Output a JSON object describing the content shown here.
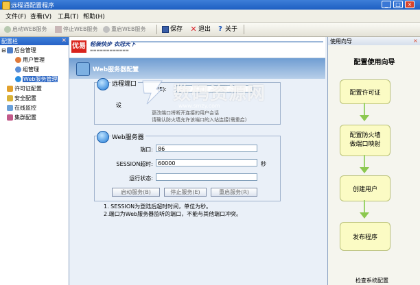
{
  "window": {
    "title": "远程通配置程序"
  },
  "menubar": [
    {
      "label": "文件(F)"
    },
    {
      "label": "查看(V)"
    },
    {
      "label": "工具(T)"
    },
    {
      "label": "帮助(H)"
    }
  ],
  "toolbar": {
    "start_web": "启动WEB服务",
    "stop_web": "停止WEB服务",
    "restart_web": "重启WEB服务",
    "save": "保存",
    "exit": "退出",
    "about": "关于"
  },
  "left_panel": {
    "title": "配置栏",
    "close": "×",
    "tree": [
      {
        "label": "后台管理",
        "level": 0,
        "expander": "⊟"
      },
      {
        "label": "用户管理",
        "level": 1
      },
      {
        "label": "组管理",
        "level": 1
      },
      {
        "label": "Web服务管理",
        "level": 1,
        "selected": true
      },
      {
        "label": "许可证配置",
        "level": 0
      },
      {
        "label": "安全配置",
        "level": 0
      },
      {
        "label": "在线监控",
        "level": 0
      },
      {
        "label": "集群配置",
        "level": 0
      }
    ]
  },
  "main": {
    "logo_text": "优易",
    "slogan": "轻装快步 衣冠天下",
    "section_title": "Web服务器配置",
    "remote_port": {
      "title": "远程端口",
      "field_suffix": "(E):",
      "row2_label": "设",
      "desc_line1": "更改端口将断开连接的用户会话",
      "desc_line2": "请确认防火墙允许该端口的入站连接(需重启)"
    },
    "web_server": {
      "title": "Web服务器",
      "port_label": "端口:",
      "port_value": "86",
      "session_label": "SESSION超时:",
      "session_value": "60000",
      "session_unit": "秒",
      "status_label": "运行状态:",
      "status_value": "",
      "btn_start": "启动服务(B)",
      "btn_stop": "停止服务(E)",
      "btn_restart": "重启服务(R)"
    },
    "notes": [
      "1. SESSION为登陆后超时时间，单位为秒。",
      "2.端口为Web服务器监听的端口，不能与其他端口冲突。"
    ]
  },
  "wizard": {
    "panel_title": "使用向导",
    "close": "×",
    "title": "配置使用向导",
    "steps": [
      {
        "label": "配置许可证"
      },
      {
        "label": "配置防火墙\n做端口映射"
      },
      {
        "label": "创建用户"
      },
      {
        "label": "发布程序"
      }
    ],
    "check_button": "检查系统配置"
  },
  "watermark": {
    "text": "数码资源网",
    "url": "www.smzy.com"
  },
  "colors": {
    "titlebar": "#1e5fc2",
    "selection": "#316ac5",
    "step_fill": "#fbfbc4",
    "arrow": "#8cc84f",
    "close_red": "#d8432b"
  }
}
